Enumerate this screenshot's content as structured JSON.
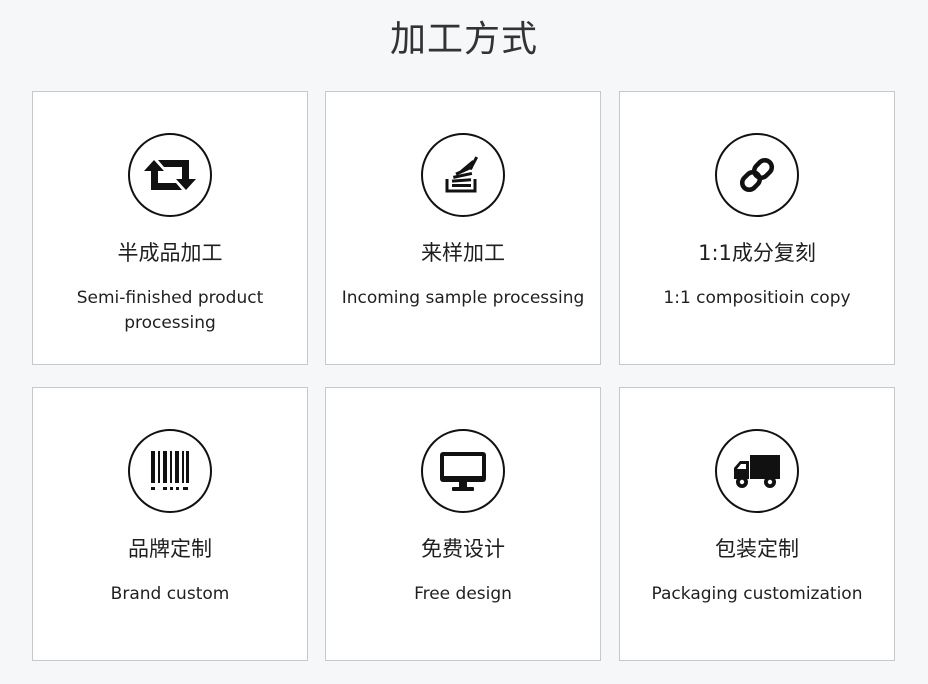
{
  "page": {
    "title": "加工方式"
  },
  "cards": [
    {
      "title": "半成品加工",
      "description": "Semi-finished product processing",
      "icon": "retweet-icon"
    },
    {
      "title": "来样加工",
      "description": "Incoming sample processing",
      "icon": "stack-icon"
    },
    {
      "title": "1:1成分复刻",
      "description": "1:1 compositioin copy",
      "icon": "chain-link-icon"
    },
    {
      "title": "品牌定制",
      "description": "Brand custom",
      "icon": "barcode-icon"
    },
    {
      "title": "免费设计",
      "description": "Free design",
      "icon": "monitor-icon"
    },
    {
      "title": "包装定制",
      "description": "Packaging customization",
      "icon": "delivery-truck-icon"
    }
  ],
  "colors": {
    "background": "#f6f7f9",
    "card": "#ffffff",
    "border": "#c8c8c8",
    "icon": "#111111"
  }
}
